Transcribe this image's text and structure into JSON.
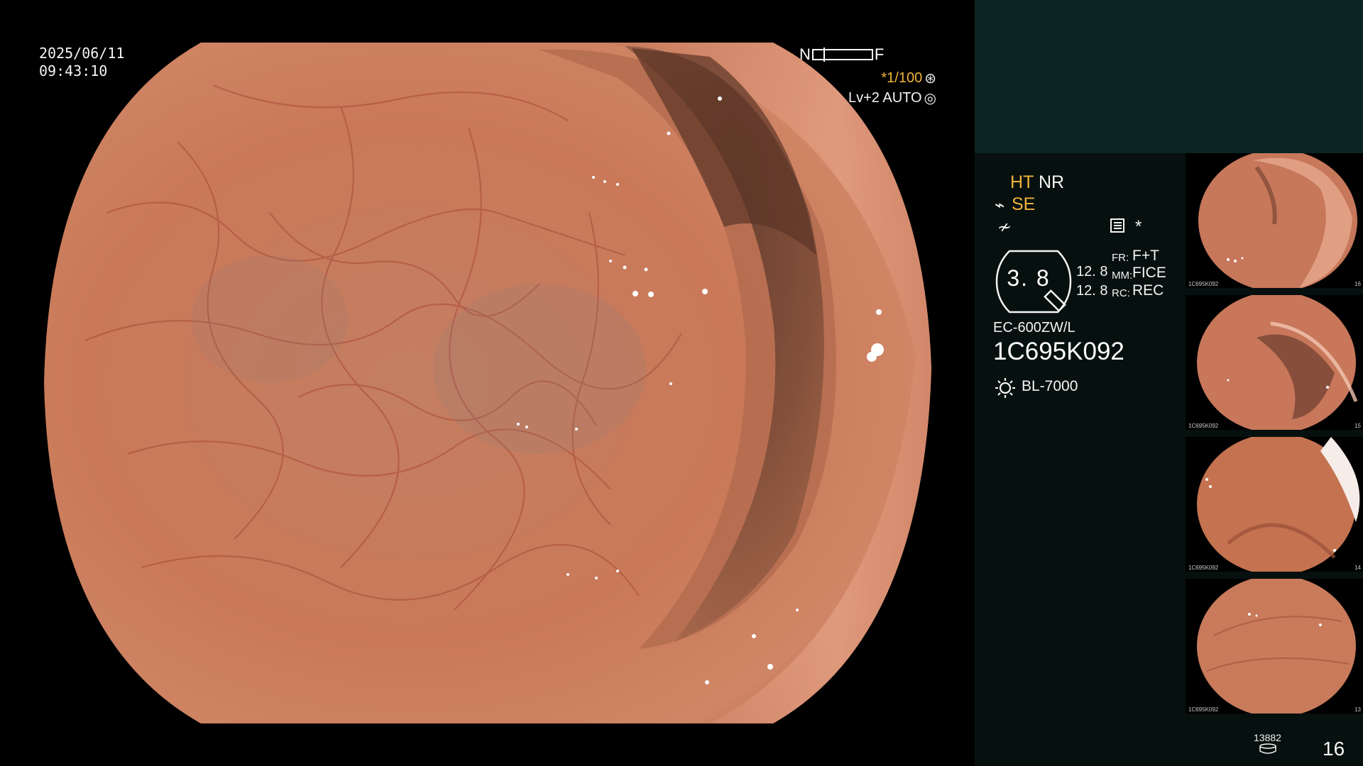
{
  "osd": {
    "date": "2025/06/11",
    "time": "09:43:10",
    "nf_left": "N",
    "nf_right": "F",
    "nf_level": 0.18,
    "shutter": "*1/100",
    "shutter_icon": "aperture-icon",
    "iris": "Lv+2 AUTO",
    "iris_icon": "iris-icon"
  },
  "panel": {
    "ht": "HT",
    "nr": "NR",
    "se_icon": "scope-icon",
    "se": "SE",
    "contrast_icon": "contrast-icon",
    "menu_icon": "menu-icon",
    "asterisk": "*",
    "zoom": "3. 8",
    "pair_1": "12. 8",
    "pair_2": "12. 8",
    "fr_key": "FR:",
    "fr_val": "F+T",
    "mm_key": "MM:",
    "mm_val": "FICE",
    "rc_key": "RC:",
    "rc_val": "REC",
    "scope_model": "EC-600ZW/L",
    "scope_serial": "1C695K092",
    "light_icon": "sun-icon",
    "light_source": "BL-7000",
    "storage_count": "13882",
    "storage_icon": "storage-disk-icon",
    "image_count": "16"
  },
  "thumbnails": [
    {
      "id": "1C695K092",
      "num": "16"
    },
    {
      "id": "1C695K092",
      "num": "15"
    },
    {
      "id": "1C695K092",
      "num": "14"
    },
    {
      "id": "1C695K092",
      "num": "13"
    }
  ],
  "colors": {
    "accent_orange": "#f0b43a",
    "panel_bg": "#06100f",
    "panel_top_bg": "#0c2423",
    "tissue": "#c97a5a"
  }
}
